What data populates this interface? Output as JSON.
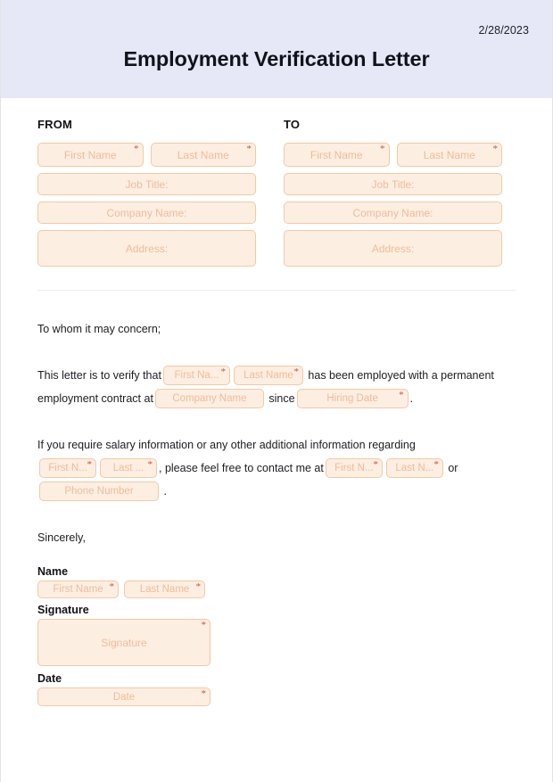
{
  "header": {
    "date": "2/28/2023",
    "title": "Employment Verification Letter"
  },
  "sections": {
    "from_label": "FROM",
    "to_label": "TO"
  },
  "address_fields": {
    "first_name": "First Name",
    "last_name": "Last Name",
    "job_title": "Job Title:",
    "company_name": "Company Name:",
    "address": "Address:"
  },
  "letter": {
    "salutation": "To whom it may concern;",
    "p1_a": "This letter is to verify that",
    "p1_b": "has been employed with a permanent",
    "p1_c": "employment contract at",
    "p1_d": "since",
    "p1_e": ".",
    "p2_a": "If you require salary information or any other additional information regarding",
    "p2_b": ", please feel free to contact me at",
    "p2_c": "or",
    "p2_d": ".",
    "closing": "Sincerely,"
  },
  "inline_fields": {
    "first_na_trunc": "First Na...",
    "last_name": "Last Name",
    "company_name": "Company Name",
    "hiring_date": "Hiring Date",
    "first_n_trunc": "First N...",
    "last_trunc": "Last ...",
    "last_n_trunc": "Last N...",
    "phone_number": "Phone Number"
  },
  "signature": {
    "name_label": "Name",
    "first_name": "First Name",
    "last_name": "Last Name",
    "signature_label": "Signature",
    "signature_placeholder": "Signature",
    "date_label": "Date",
    "date_placeholder": "Date"
  },
  "colors": {
    "header_bg": "#e6e8f7",
    "field_bg": "#fdeee2",
    "field_border": "#f3c9a4",
    "placeholder": "#f0bc97",
    "required_asterisk": "#e0493c",
    "text": "#1d1d22"
  },
  "required_marker": "*"
}
